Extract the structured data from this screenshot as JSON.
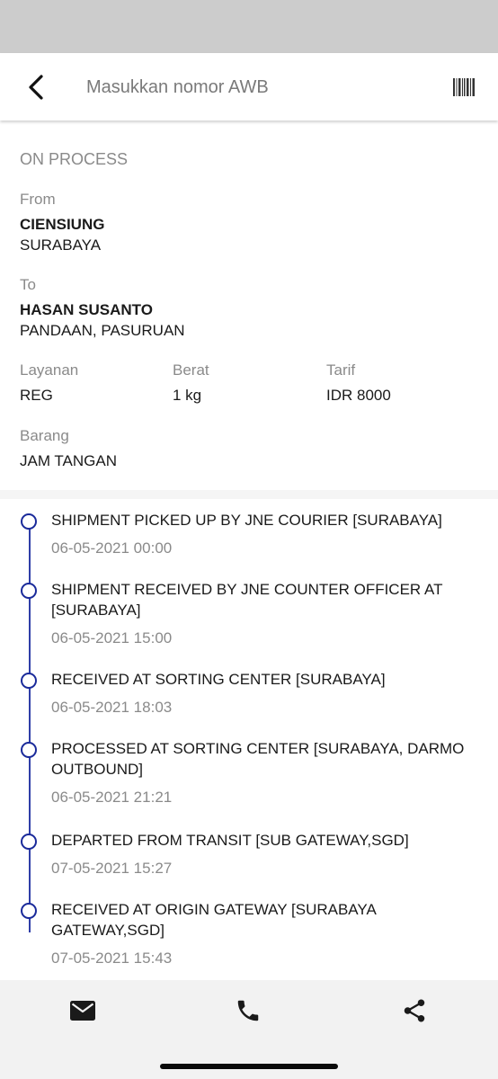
{
  "header": {
    "search_placeholder": "Masukkan nomor AWB",
    "icons": {
      "back": "back-arrow-icon",
      "scan": "barcode-icon"
    }
  },
  "shipment": {
    "status": "ON PROCESS",
    "from_label": "From",
    "from_name": "CIENSIUNG",
    "from_city": "SURABAYA",
    "to_label": "To",
    "to_name": "HASAN SUSANTO",
    "to_city": "PANDAAN, PASURUAN",
    "layanan_label": "Layanan",
    "layanan_value": "REG",
    "berat_label": "Berat",
    "berat_value": "1 kg",
    "tarif_label": "Tarif",
    "tarif_value": "IDR 8000",
    "barang_label": "Barang",
    "barang_value": "JAM TANGAN"
  },
  "history": [
    {
      "desc": "SHIPMENT PICKED UP BY JNE COURIER [SURABAYA]",
      "time": "06-05-2021 00:00"
    },
    {
      "desc": "SHIPMENT RECEIVED BY JNE COUNTER OFFICER AT [SURABAYA]",
      "time": "06-05-2021 15:00"
    },
    {
      "desc": "RECEIVED AT SORTING CENTER [SURABAYA]",
      "time": "06-05-2021 18:03"
    },
    {
      "desc": "PROCESSED AT SORTING CENTER [SURABAYA, DARMO OUTBOUND]",
      "time": "06-05-2021 21:21"
    },
    {
      "desc": "DEPARTED FROM TRANSIT [SUB GATEWAY,SGD]",
      "time": "07-05-2021 15:27"
    },
    {
      "desc": "RECEIVED AT ORIGIN GATEWAY [SURABAYA GATEWAY,SGD]",
      "time": "07-05-2021 15:43"
    }
  ],
  "actions": {
    "icons": [
      "mail-icon",
      "phone-icon",
      "share-icon"
    ]
  },
  "colors": {
    "timeline_accent": "#1a2a9a",
    "muted_text": "#8a8a8a",
    "status_bar": "#cccccc"
  }
}
